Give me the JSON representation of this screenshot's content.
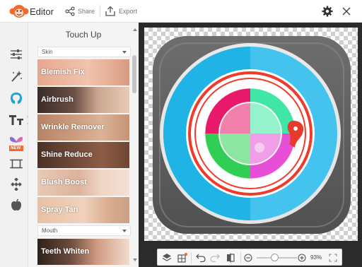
{
  "header": {
    "app_name": "Editor",
    "share_label": "Share",
    "export_label": "Export"
  },
  "panel": {
    "title": "Touch Up",
    "sections": [
      {
        "label": "Skin"
      },
      {
        "label": "Mouth"
      }
    ],
    "tools": [
      {
        "label": "Blemish Fix"
      },
      {
        "label": "Airbrush"
      },
      {
        "label": "Wrinkle Remover"
      },
      {
        "label": "Shine Reduce"
      },
      {
        "label": "Blush Boost"
      },
      {
        "label": "Spray Tan"
      },
      {
        "label": "Teeth Whiten"
      }
    ]
  },
  "toolrail": {
    "new_badge": "NEW"
  },
  "bottombar": {
    "zoom_level": "93%"
  },
  "colors": {
    "accent": "#f06a2a",
    "cyan": "#29b6e8",
    "pink": "#e8196b",
    "green": "#2fcf55",
    "magenta": "#e64fd6",
    "mint": "#40e6a5",
    "red_ring": "#f03a2a"
  }
}
